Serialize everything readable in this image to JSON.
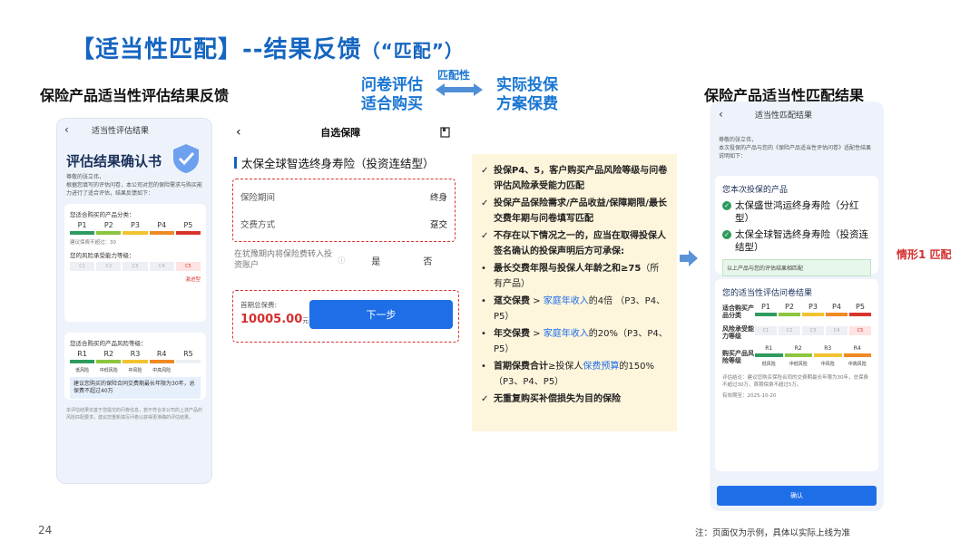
{
  "slide": {
    "title": "【适当性匹配】--结果反馈",
    "title_sub": "（“匹配”）",
    "left_section": "保险产品适当性评估结果反馈",
    "right_section": "保险产品适当性匹配结果",
    "flow": {
      "left": [
        "问卷评估",
        "适合购买"
      ],
      "middle": "匹配性",
      "right": [
        "实际投保",
        "方案保费"
      ]
    },
    "situation_label": "情形1 匹配",
    "page_number": "24",
    "footnote": "注：页面仅为示例，具体以实际上线为准"
  },
  "left_phone": {
    "header": "适当性评估结果",
    "title": "评估结果确认书",
    "greeting": "尊敬的张立伟，",
    "intro": "根据您填写的评估问卷，本公司对您的保险需求与购买能力进行了适合评估，结果反馈如下：",
    "card1": {
      "product_label": "您适合购买的产品分类：",
      "product_levels": [
        "P1",
        "P2",
        "P3",
        "P4",
        "P5"
      ],
      "product_note": "建议保费不超过：30",
      "ability_label": "您的风险承受能力等级：",
      "ability_levels": [
        "C1",
        "C2",
        "C3",
        "C4",
        "C5"
      ],
      "ability_note": "激进型"
    },
    "card2": {
      "risk_label": "您适合购买的产品风险等级：",
      "risk_levels": [
        "R1",
        "R2",
        "R3",
        "R4",
        "R5"
      ],
      "risk_names": [
        "低风险",
        "中低风险",
        "中风险",
        "中高风险"
      ],
      "note": "建议您购买的保险合同交费期最长年限为30年，总保费不超过40万"
    },
    "footer": "本评估结果仅基于您提交的问卷信息，若不符合本公司的上述产品的风险匹配要求，建议您重新填写问卷以获得更准确的评估结果。"
  },
  "mid_phone": {
    "header": "自选保障",
    "product": "太保全球智选终身寿险（投资连结型）",
    "rows": [
      {
        "label": "保险期间",
        "value": "终身"
      },
      {
        "label": "交费方式",
        "value": "趸交"
      }
    ],
    "question": "在犹豫期内将保险费转入投资账户",
    "options": [
      "是",
      "否"
    ],
    "pay_label": "首期总保费:",
    "pay_amount": "10005.00",
    "pay_unit": "元",
    "next_button": "下一步"
  },
  "rules": [
    {
      "mark": "✓",
      "parts": [
        {
          "t": "投保P4、5，客户购买产品风险等级与问卷评估风险承受能力匹配",
          "s": "b"
        }
      ]
    },
    {
      "mark": "✓",
      "parts": [
        {
          "t": "投保产品保险需求/产品收益/保障期限/最长交费年期与问卷填写匹配",
          "s": "b"
        }
      ]
    },
    {
      "mark": "✓",
      "parts": [
        {
          "t": "不存在以下情况之一的，应当在取得投保人签名确认的投保声明后方可承保:",
          "s": "b"
        }
      ]
    },
    {
      "mark": "•",
      "parts": [
        {
          "t": "最长交费年限与投保人年龄之和≥75",
          "s": "b"
        },
        {
          "t": "（所有产品）",
          "s": "n"
        }
      ]
    },
    {
      "mark": "•",
      "parts": [
        {
          "t": "趸交保费",
          "s": "b"
        },
        {
          "t": " > ",
          "s": "n"
        },
        {
          "t": "家庭年收入",
          "s": "blue"
        },
        {
          "t": "的4倍 （P3、P4、P5）",
          "s": "n"
        }
      ]
    },
    {
      "mark": "•",
      "parts": [
        {
          "t": "年交保费",
          "s": "b"
        },
        {
          "t": " > ",
          "s": "n"
        },
        {
          "t": "家庭年收入",
          "s": "blue"
        },
        {
          "t": "的20%（P3、P4、P5）",
          "s": "n"
        }
      ]
    },
    {
      "mark": "•",
      "parts": [
        {
          "t": "首期保费合计",
          "s": "b"
        },
        {
          "t": "≥投保人",
          "s": "n"
        },
        {
          "t": "保费预算",
          "s": "blue"
        },
        {
          "t": "的150% （P3、P4、P5）",
          "s": "n"
        }
      ]
    },
    {
      "mark": "✓",
      "parts": [
        {
          "t": "无重复购买补偿损失为目的保险",
          "s": "b"
        }
      ]
    }
  ],
  "right_phone": {
    "header": "适当性匹配结果",
    "greeting": "尊敬的张立伟，",
    "intro": "本次投保的产品与您的《保险产品适当性评估问卷》适配性结果说明如下：",
    "products_title": "您本次投保的产品",
    "products": [
      "太保盛世鸿运终身寿险（分红型）",
      "太保全球智选终身寿险（投资连结型）"
    ],
    "match_note": "以上产品与您的评估结果相匹配",
    "results_title": "您的适当性评估问卷结果",
    "row_labels": [
      "适合购买产品分类",
      "风险承受能力等级",
      "购买产品风险等级"
    ],
    "p_levels": [
      "P1",
      "P2",
      "P3",
      "P4",
      "P5"
    ],
    "c_levels": [
      "C1",
      "C2",
      "C3",
      "C4",
      "C5"
    ],
    "r_levels": [
      "R1",
      "R2",
      "R3",
      "R4"
    ],
    "r_names": [
      "低风险",
      "中低风险",
      "中风险",
      "中高风险"
    ],
    "eval_text": "评估结论：建议您购买保险合同的交费期最长年限为30年，总保费不超过30万，首期保费不超过5万。",
    "valid_text": "有效期至：2025-10-20",
    "confirm": "确认"
  },
  "colors": {
    "title_blue": "#1565c0",
    "accent_red": "#d32f2f",
    "button_blue": "#1e6ee8",
    "rules_bg": "#fdf5dc",
    "level_colors": [
      "#2e9b5e",
      "#8cc63f",
      "#f2c230",
      "#f08a24",
      "#d9342b"
    ]
  }
}
